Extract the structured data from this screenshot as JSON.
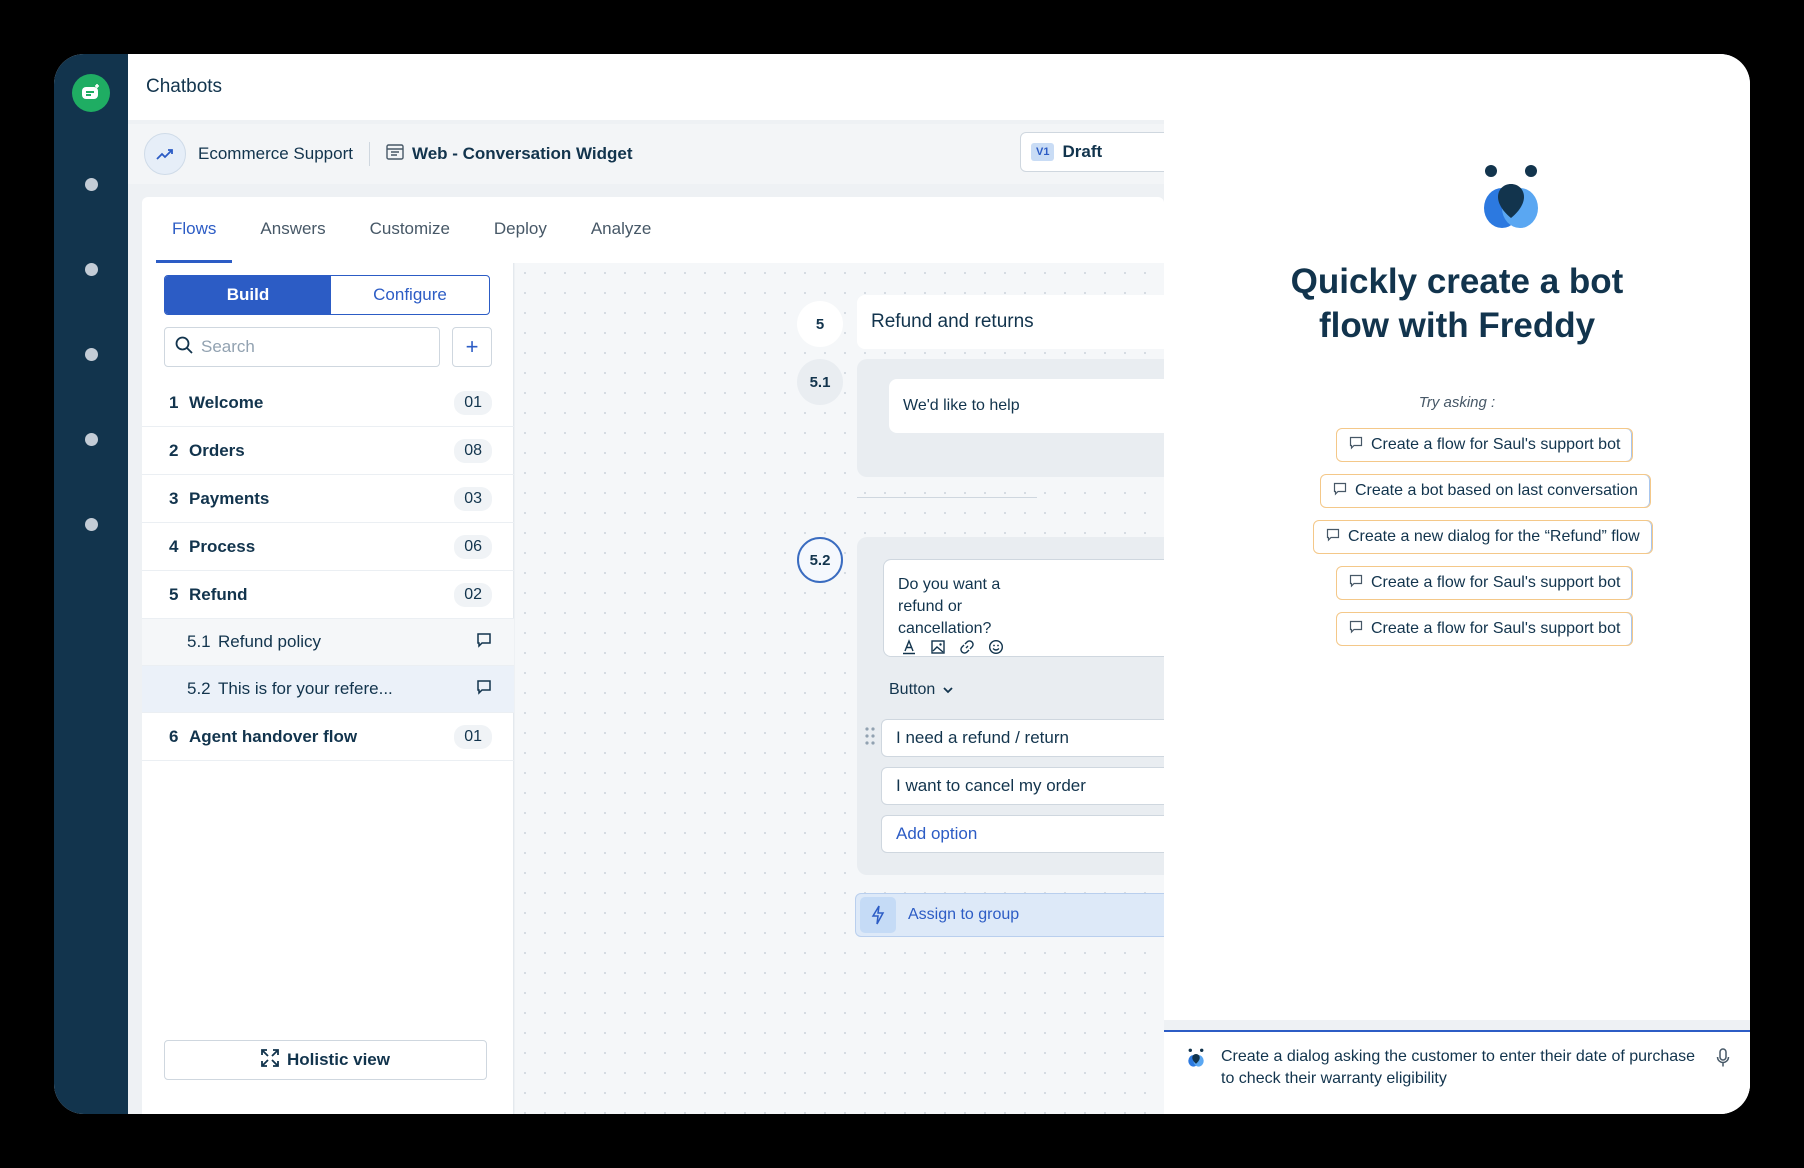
{
  "app": {
    "title": "Chatbots"
  },
  "subbar": {
    "bot_name": "Ecommerce Support",
    "channel": "Web - Conversation Widget",
    "version_badge": "V1",
    "version_label": "Draft"
  },
  "tabs": [
    {
      "label": "Flows"
    },
    {
      "label": "Answers"
    },
    {
      "label": "Customize"
    },
    {
      "label": "Deploy"
    },
    {
      "label": "Analyze"
    }
  ],
  "segment": {
    "build": "Build",
    "configure": "Configure"
  },
  "search": {
    "placeholder": "Search"
  },
  "flows": [
    {
      "num": "1",
      "name": "Welcome",
      "count": "01"
    },
    {
      "num": "2",
      "name": "Orders",
      "count": "08"
    },
    {
      "num": "3",
      "name": "Payments",
      "count": "03"
    },
    {
      "num": "4",
      "name": "Process",
      "count": "06"
    },
    {
      "num": "5",
      "name": "Refund",
      "count": "02"
    }
  ],
  "subflows": [
    {
      "num": "5.1",
      "name": "Refund policy"
    },
    {
      "num": "5.2",
      "name": "This is for your refere..."
    }
  ],
  "last_flow": {
    "num": "6",
    "name": "Agent handover flow",
    "count": "01"
  },
  "holistic_view": "Holistic view",
  "canvas": {
    "step5_badge": "5",
    "step5_title": "Refund and returns",
    "step51_badge": "5.1",
    "step51_text": "We'd like to help",
    "step52_badge": "5.2",
    "step52_text": "Do you want a refund or cancellation?",
    "response_type": "Button",
    "options": [
      "I need a refund / return",
      "I want to cancel my order"
    ],
    "add_option": "Add option",
    "action": "Assign to group"
  },
  "freddy": {
    "title_line1": "Quickly create a bot",
    "title_line2": "flow with Freddy",
    "try_asking": "Try asking :",
    "suggestions": [
      "Create a flow for Saul's support bot",
      "Create a bot based on last conversation",
      "Create a new dialog for the “Refund” flow",
      "Create a flow for Saul's support bot",
      "Create a flow for Saul's support bot"
    ],
    "prompt": "Create a dialog asking the customer to enter their date of purchase to check their warranty eligibility"
  },
  "colors": {
    "rail": "#12344d",
    "accent": "#2c5cc5",
    "brand_green": "#1fad63",
    "chip_border": "#f4c889"
  }
}
